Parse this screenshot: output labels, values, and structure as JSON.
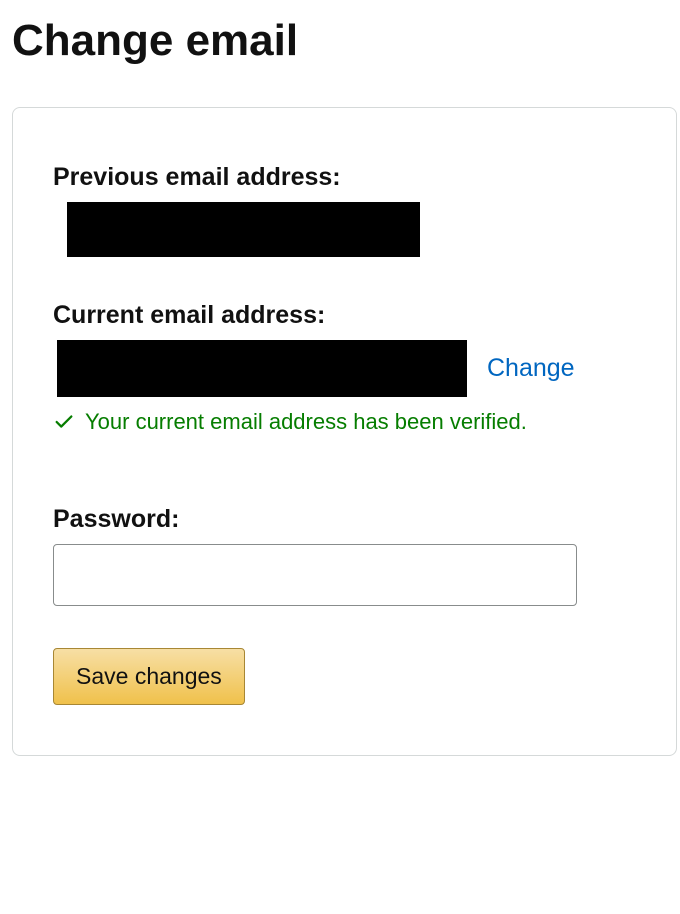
{
  "title": "Change email",
  "previous_email": {
    "label": "Previous email address:",
    "value": ""
  },
  "current_email": {
    "label": "Current email address:",
    "value": "",
    "change_link": "Change",
    "verified_message": "Your current email address has been verified."
  },
  "password": {
    "label": "Password:",
    "value": ""
  },
  "save_button": "Save changes"
}
